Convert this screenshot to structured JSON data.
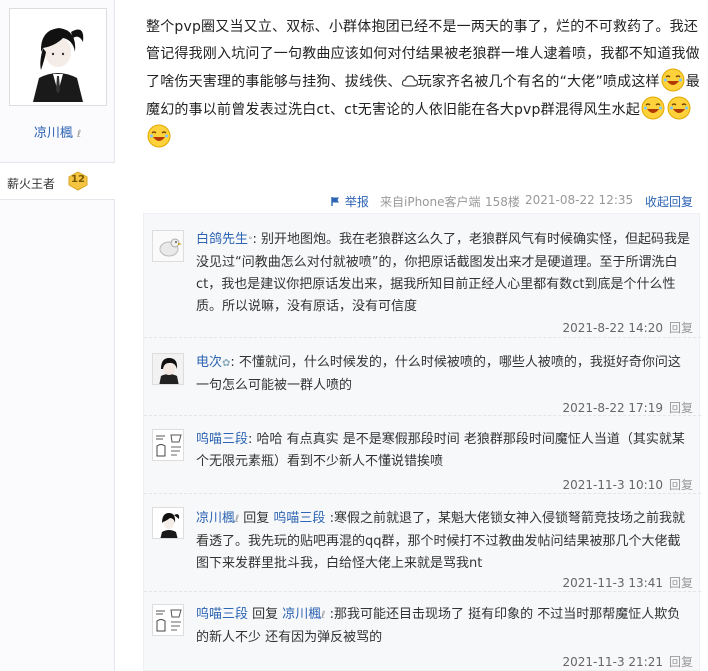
{
  "author": {
    "name": "凉川楓",
    "level_name": "薪火王者",
    "level_num": "12"
  },
  "post": {
    "seg1": "整个pvp圈又当又立、双标、小群体抱团已经不是一两天的事了，烂的不可救药了。我还管记得我刚入坑问了一句教曲应该如何对付结果被老狼群一堆人逮着喷，我都不知道我做了啥伤天害理的事能够与挂狗、拔线佚、",
    "seg2": "玩家齐名被几个有名的“大佬”喷成这样",
    "seg3": "最魔幻的事以前曾发表过洗白ct、ct无害论的人依旧能在各大pvp群混得风生水起"
  },
  "post_tail": {
    "report": "举报",
    "source": "来自iPhone客户端",
    "floor": "158楼",
    "time": "2021-08-22 12:35",
    "collapse": "收起回复"
  },
  "replies": [
    {
      "name": "白鸽先生",
      "prefix": "",
      "reply_to": "",
      "text": ": 别开地图炮。我在老狼群这么久了，老狼群风气有时候确实怪，但起码我是没见过“问教曲怎么对付就被喷”的，你把原话截图发出来才是硬道理。至于所谓洗白ct，我也是建议你把原话发出来，据我所知目前正经人心里都有数ct到底是个什么性质。所以说嘛，没有原话，没有可信度",
      "time": "2021-8-22 14:20",
      "reply_label": "回复"
    },
    {
      "name": "电次",
      "prefix": "",
      "reply_to": "",
      "text": ": 不懂就问，什么时候发的，什么时候被喷的，哪些人被喷的，我挺好奇你问这一句怎么可能被一群人喷的",
      "time": "2021-8-22 17:19",
      "reply_label": "回复"
    },
    {
      "name": "呜喵三段",
      "prefix": "",
      "reply_to": "",
      "text": ": 哈哈 有点真实 是不是寒假那段时间 老狼群那段时间魔怔人当道（其实就某个无限元素瓶）看到不少新人不懂说错挨喷",
      "time": "2021-11-3 10:10",
      "reply_label": "回复"
    },
    {
      "name": "凉川楓",
      "prefix": " 回复 ",
      "reply_to": "呜喵三段",
      "text": " :寒假之前就退了，某魁大佬锁女神入侵锁弩箭竞技场之前我就看透了。我先玩的贴吧再混的qq群，那个时候打不过教曲发帖问结果被那几个大佬截图下来发群里批斗我，白给怪大佬上来就是骂我nt",
      "time": "2021-11-3 13:41",
      "reply_label": "回复"
    },
    {
      "name": "呜喵三段",
      "prefix": " 回复 ",
      "reply_to": "凉川楓",
      "text": " :那我可能还目击现场了 挺有印象的 不过当时那帮魔怔人欺负的新人不少 还有因为弹反被骂的",
      "time": "2021-11-3 21:21",
      "reply_label": "回复"
    }
  ],
  "colors": {
    "link": "#2d64b3",
    "meta": "#999999",
    "reply_bg": "#f7f8fa",
    "badge": "#f5c542"
  },
  "icons": [
    "author-avatar",
    "verified-icon",
    "level-badge-icon",
    "cloud-icon",
    "laugh-emoji",
    "report-icon"
  ]
}
